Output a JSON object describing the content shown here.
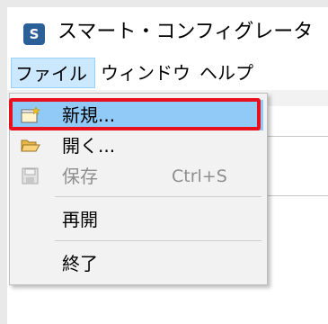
{
  "window": {
    "title": "スマート・コンフィグレータ",
    "icon": "app-logo-icon",
    "icon_glyph": "S"
  },
  "menubar": {
    "items": [
      {
        "label": "ファイル",
        "active": true
      },
      {
        "label": "ウィンドウ",
        "active": false
      },
      {
        "label": "ヘルプ",
        "active": false
      }
    ]
  },
  "file_menu": {
    "items": [
      {
        "label": "新規...",
        "icon": "new-file-icon",
        "shortcut": "",
        "enabled": true,
        "highlighted": true
      },
      {
        "label": "開く...",
        "icon": "open-folder-icon",
        "shortcut": "",
        "enabled": true,
        "highlighted": false
      },
      {
        "label": "保存",
        "icon": "save-disk-icon",
        "shortcut": "Ctrl+S",
        "enabled": false,
        "highlighted": false
      },
      {
        "label": "再開",
        "icon": "",
        "shortcut": "",
        "enabled": true,
        "highlighted": false
      },
      {
        "label": "終了",
        "icon": "",
        "shortcut": "",
        "enabled": true,
        "highlighted": false
      }
    ]
  },
  "colors": {
    "highlight_fill": "#91c9f7",
    "callout_border": "#e8101c",
    "menubar_active": "#cce8ff",
    "disabled_text": "#8e8e8e"
  }
}
